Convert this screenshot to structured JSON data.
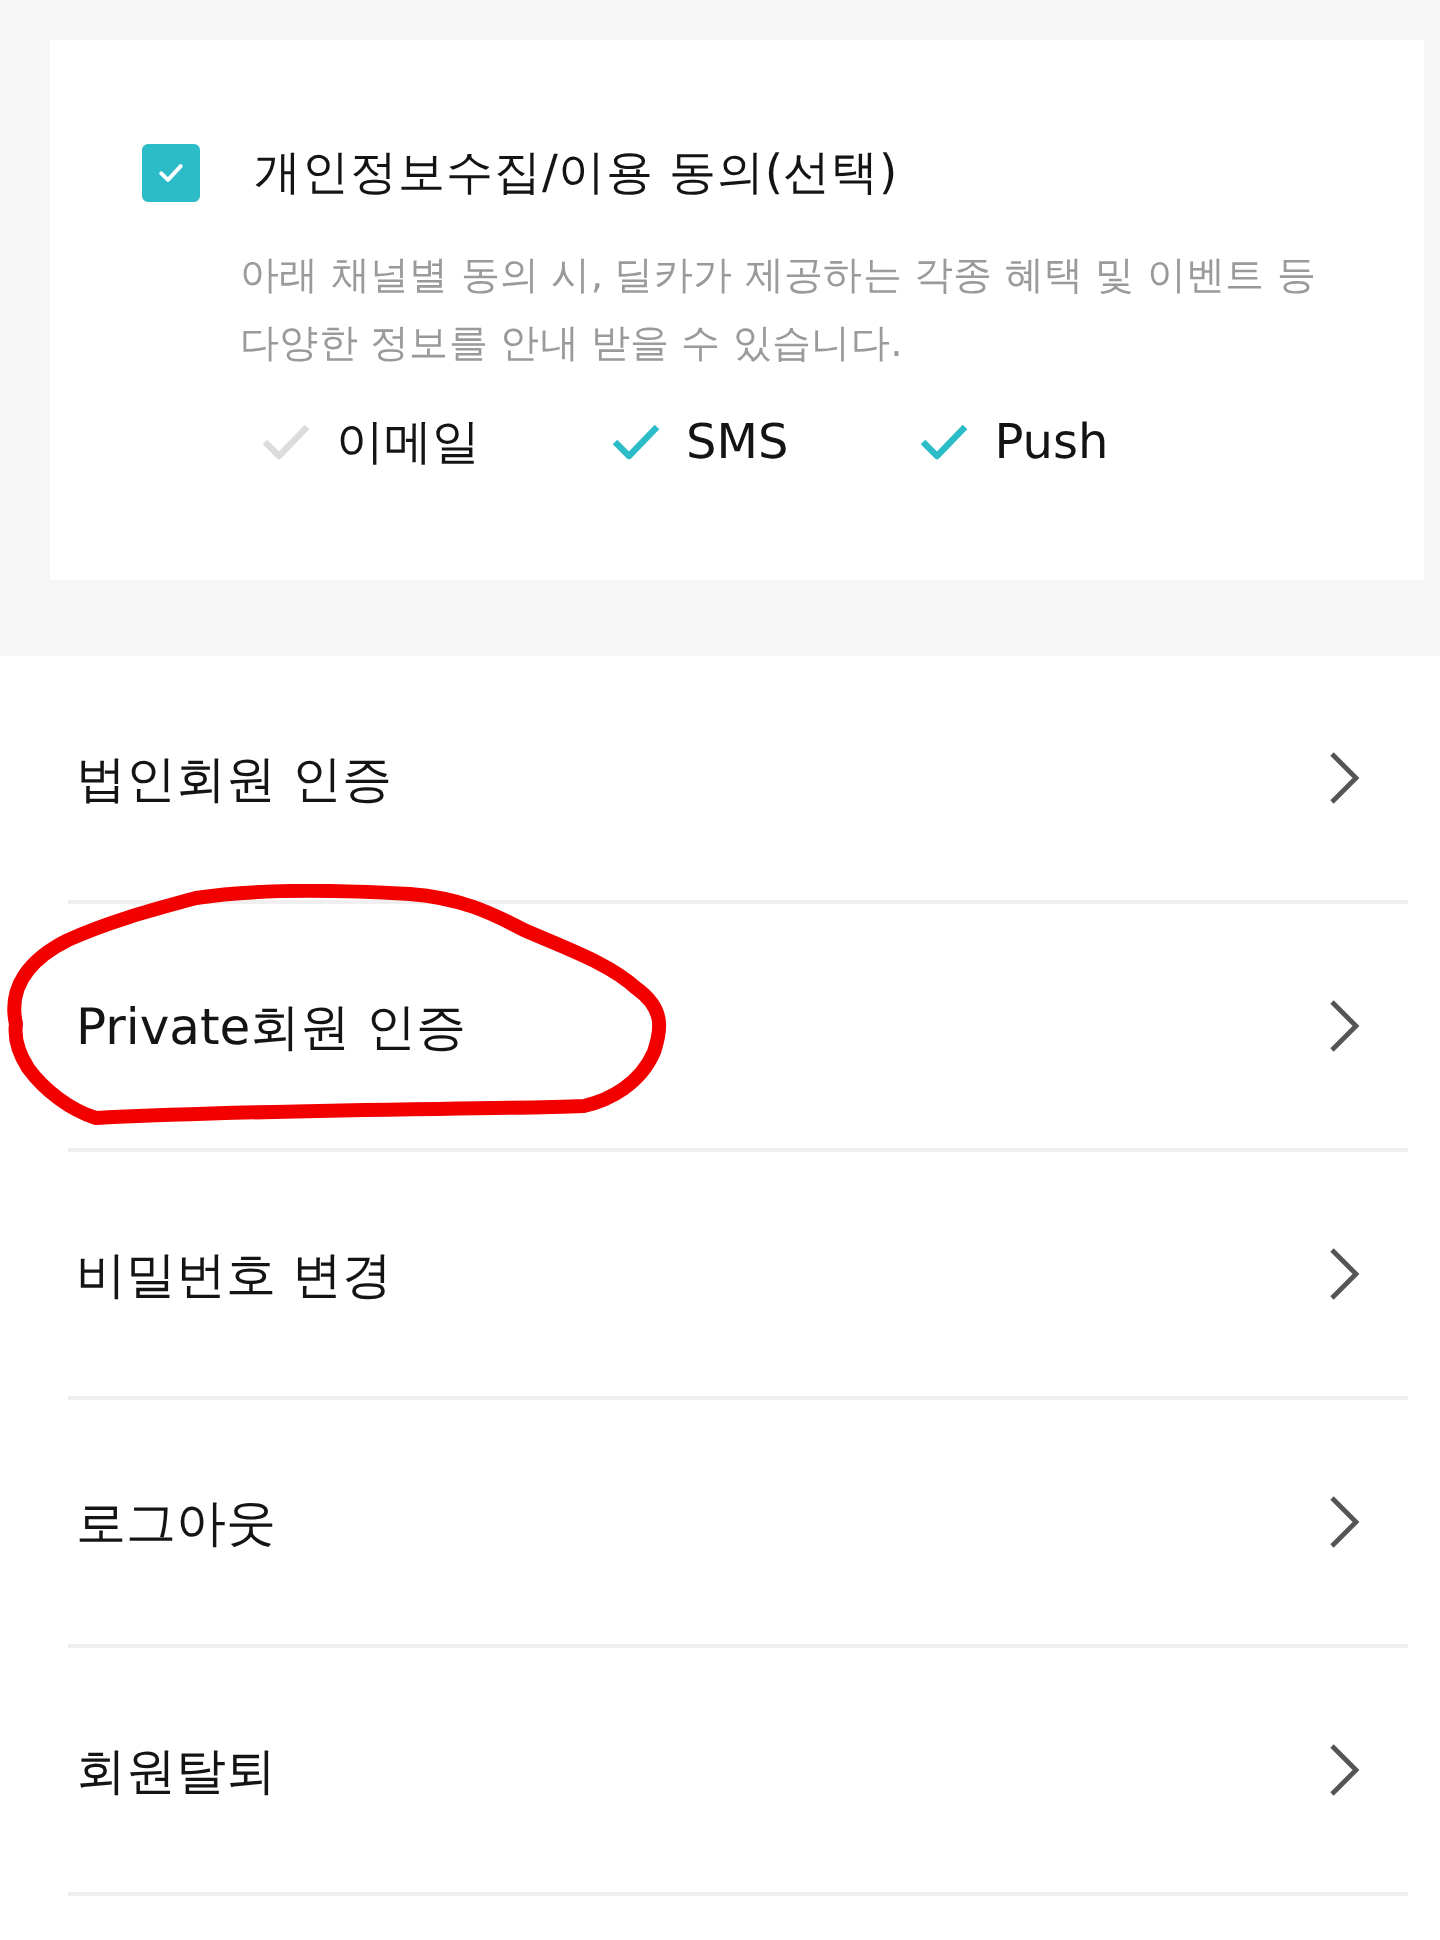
{
  "consent": {
    "checked": true,
    "title": "개인정보수집/이용 동의(선택)",
    "description": "아래 채널별 동의 시, 딜카가 제공하는 각종 혜택 및 이벤트 등 다양한 정보를 안내 받을 수 있습니다.",
    "channels": [
      {
        "label": "이메일",
        "checked": false
      },
      {
        "label": "SMS",
        "checked": true
      },
      {
        "label": "Push",
        "checked": true
      }
    ]
  },
  "menu": [
    {
      "label": "법인회원 인증",
      "circled": false
    },
    {
      "label": "Private회원 인증",
      "circled": true
    },
    {
      "label": "비밀번호 변경",
      "circled": false
    },
    {
      "label": "로그아웃",
      "circled": false
    },
    {
      "label": "회원탈퇴",
      "circled": false
    }
  ]
}
